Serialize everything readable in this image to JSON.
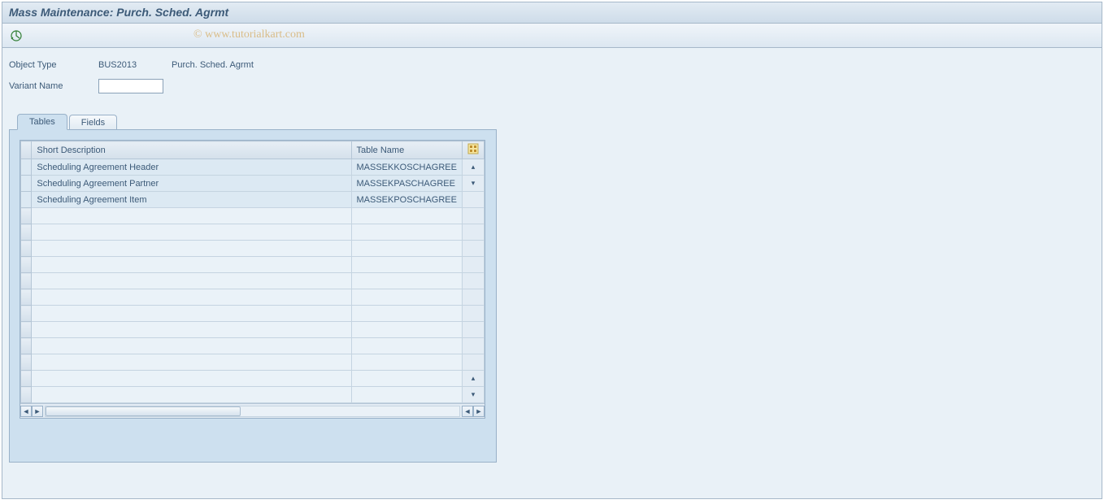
{
  "title": "Mass Maintenance: Purch. Sched. Agrmt",
  "watermark": "© www.tutorialkart.com",
  "fields": {
    "object_type_label": "Object Type",
    "object_type_value": "BUS2013",
    "object_type_desc": "Purch. Sched. Agrmt",
    "variant_name_label": "Variant Name",
    "variant_name_value": ""
  },
  "tabs": {
    "tables": "Tables",
    "fields": "Fields"
  },
  "grid": {
    "columns": {
      "short_description": "Short Description",
      "table_name": "Table Name"
    },
    "rows": [
      {
        "desc": "Scheduling Agreement Header",
        "table": "MASSEKKOSCHAGREE"
      },
      {
        "desc": "Scheduling Agreement Partner",
        "table": "MASSEKPASCHAGREE"
      },
      {
        "desc": "Scheduling Agreement Item",
        "table": "MASSEKPOSCHAGREE"
      }
    ],
    "empty_rows": 12
  }
}
